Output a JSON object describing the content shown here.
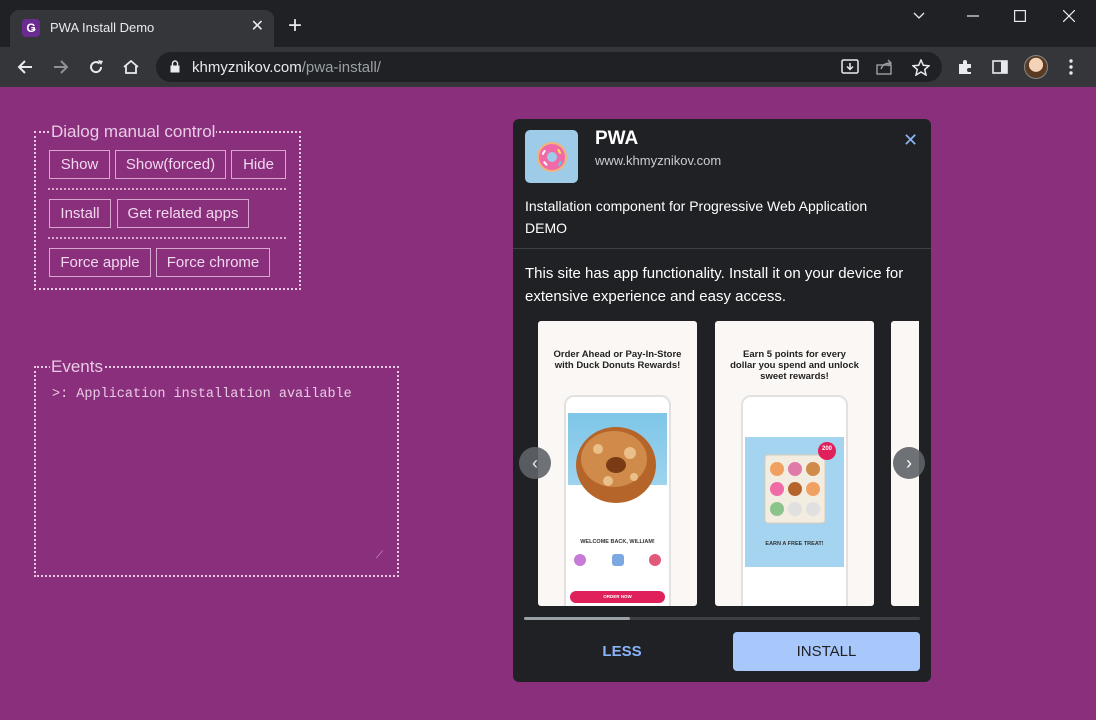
{
  "browser": {
    "tab_title": "PWA Install Demo",
    "tab_favicon": "Ǥ",
    "url_domain": "khmyznikov.com",
    "url_path": "/pwa-install/"
  },
  "controls": {
    "dialog_legend": "Dialog manual control",
    "show": "Show",
    "show_forced": "Show(forced)",
    "hide": "Hide",
    "install": "Install",
    "get_related": "Get related apps",
    "force_apple": "Force apple",
    "force_chrome": "Force chrome",
    "events_legend": "Events",
    "events_log": ">: Application installation available"
  },
  "dialog": {
    "app_name": "PWA",
    "app_url": "www.khmyznikov.com",
    "description": "Installation component for Progressive Web Application DEMO",
    "info": "This site has app functionality. Install it on your device for extensive experience and easy access.",
    "screenshots": [
      {
        "headline": "Order Ahead or Pay-In-Store with Duck Donuts Rewards!",
        "caption": "WELCOME BACK, WILLIAM!",
        "button": "ORDER NOW"
      },
      {
        "headline": "Earn 5 points for every dollar you spend and unlock sweet rewards!",
        "caption": "EARN A FREE TREAT!",
        "badge": "200"
      }
    ],
    "less_label": "LESS",
    "install_label": "INSTALL"
  },
  "colors": {
    "page_bg": "#8a2f7c",
    "dialog_bg": "#202124",
    "install_bg": "#a8c7fa",
    "link": "#8ab4f8"
  }
}
